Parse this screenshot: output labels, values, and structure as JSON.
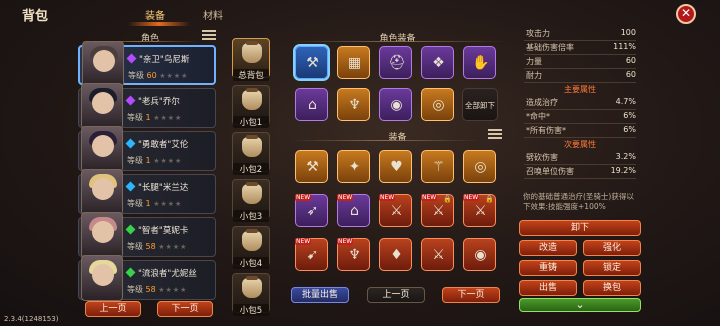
{
  "header": {
    "title": "背包",
    "tab_equip": "装备",
    "tab_materials": "材料",
    "close": "✕"
  },
  "characters": {
    "heading": "角色",
    "list": [
      {
        "name": "\"亲卫\"乌尼斯",
        "level_label": "等级",
        "level": "60",
        "gem": "#b44bff",
        "hair": "#4a3f3a"
      },
      {
        "name": "\"老兵\"乔尔",
        "level_label": "等级",
        "level": "1",
        "gem": "#b44bff",
        "hair": "#1b1d28"
      },
      {
        "name": "\"勇敢者\"艾伦",
        "level_label": "等级",
        "level": "1",
        "gem": "#2bb6ff",
        "hair": "#2b1e36"
      },
      {
        "name": "\"长腿\"米兰达",
        "level_label": "等级",
        "level": "1",
        "gem": "#2bb6ff",
        "hair": "#e0c27a"
      },
      {
        "name": "\"智者\"莫妮卡",
        "level_label": "等级",
        "level": "58",
        "gem": "#39d14a",
        "hair": "#c78a8a"
      },
      {
        "name": "\"流浪者\"尤妮丝",
        "level_label": "等级",
        "level": "58",
        "gem": "#39d14a",
        "hair": "#e6d79a"
      }
    ],
    "prev": "上一页",
    "next": "下一页"
  },
  "bags": [
    "总背包",
    "小包1",
    "小包2",
    "小包3",
    "小包4",
    "小包5"
  ],
  "char_equip": {
    "heading": "角色装备",
    "slots": [
      {
        "icon": "⚒",
        "color": "blue",
        "name": "hammer-icon",
        "selected": true
      },
      {
        "icon": "▦",
        "color": "orange",
        "name": "armor-icon"
      },
      {
        "icon": "⛑",
        "color": "purple",
        "name": "helmet-icon"
      },
      {
        "icon": "❖",
        "color": "purple",
        "name": "chest-armor-icon"
      },
      {
        "icon": "✋",
        "color": "purple",
        "name": "gauntlet-icon"
      },
      {
        "icon": "⌂",
        "color": "purple",
        "name": "boots-icon"
      },
      {
        "icon": "♆",
        "color": "orange",
        "name": "amulet-icon"
      },
      {
        "icon": "◉",
        "color": "purple",
        "name": "bracelet-icon"
      },
      {
        "icon": "◎",
        "color": "orange",
        "name": "ring-icon"
      }
    ],
    "unequip_all": "全部卸下"
  },
  "inventory": {
    "heading": "装备",
    "slots": [
      {
        "icon": "⚒",
        "color": "orange",
        "name": "hammer-icon"
      },
      {
        "icon": "✦",
        "color": "orange",
        "name": "necklace-icon"
      },
      {
        "icon": "♥",
        "color": "orange",
        "name": "heart-amulet-icon"
      },
      {
        "icon": "⚚",
        "color": "orange",
        "name": "pendant-icon"
      },
      {
        "icon": "◎",
        "color": "orange",
        "name": "ring-icon"
      },
      {
        "icon": "➶",
        "color": "purple",
        "name": "crossbow-icon",
        "tag": "NEW"
      },
      {
        "icon": "⌂",
        "color": "purple",
        "name": "boots-icon",
        "tag": "NEW"
      },
      {
        "icon": "⚔",
        "color": "red",
        "name": "sword-icon",
        "tag": "NEW"
      },
      {
        "icon": "⚔",
        "color": "red",
        "name": "sword-icon",
        "tag": "NEW",
        "lock": true
      },
      {
        "icon": "⚔",
        "color": "red",
        "name": "sword-icon",
        "tag": "NEW",
        "lock": true
      },
      {
        "icon": "➹",
        "color": "red",
        "name": "bow-icon",
        "tag": "NEW"
      },
      {
        "icon": "♆",
        "color": "red",
        "name": "amulet-icon",
        "tag": "NEW"
      },
      {
        "icon": "♦",
        "color": "red",
        "name": "gem-amulet-icon"
      },
      {
        "icon": "⚔",
        "color": "red",
        "name": "sword-icon"
      },
      {
        "icon": "◉",
        "color": "red",
        "name": "ring-icon"
      }
    ],
    "bulk_sell": "批量出售",
    "prev": "上一页",
    "next": "下一页"
  },
  "stats": {
    "base": [
      {
        "k": "攻击力",
        "v": "100"
      },
      {
        "k": "基础伤害倍率",
        "v": "111%"
      },
      {
        "k": "力量",
        "v": "60"
      },
      {
        "k": "耐力",
        "v": "60"
      }
    ],
    "main_title": "主要属性",
    "main": [
      {
        "k": "造成治疗",
        "v": "4.7%"
      },
      {
        "k": "*命中*",
        "v": "6%"
      },
      {
        "k": "*所有伤害*",
        "v": "6%"
      }
    ],
    "secondary_title": "次要属性",
    "secondary": [
      {
        "k": "劈砍伤害",
        "v": "3.2%"
      },
      {
        "k": "召唤单位伤害",
        "v": "19.2%"
      }
    ],
    "desc": "你的基础普通治疗(圣骑士)获得以下效果:技能强度+100%"
  },
  "actions": {
    "unequip": "卸下",
    "modify": "改造",
    "enhance": "强化",
    "recast": "重铸",
    "lock": "锁定",
    "sell": "出售",
    "swap_bag": "换包",
    "expand": "⌄"
  },
  "version": "2.3.4(1248153)"
}
